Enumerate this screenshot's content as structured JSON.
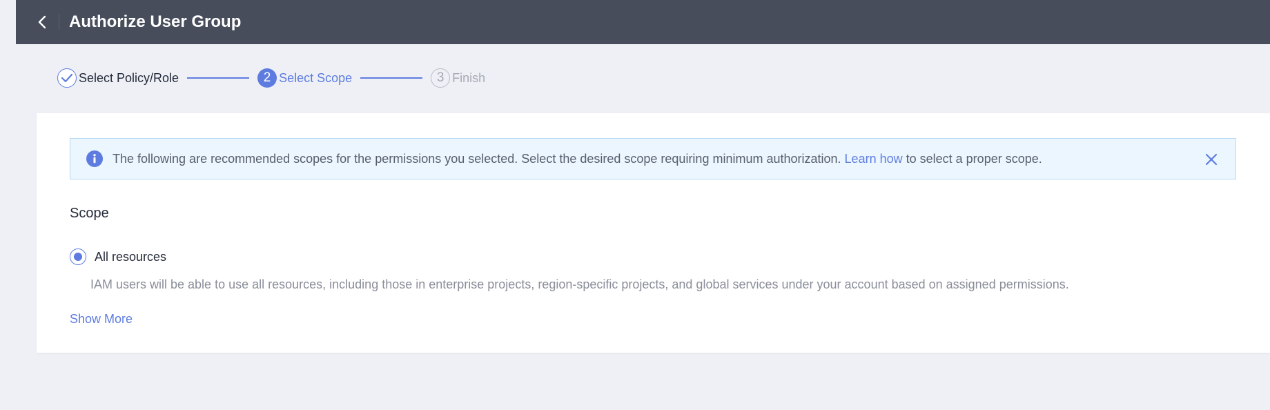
{
  "header": {
    "title": "Authorize User Group",
    "back_icon": "chevron-left-icon"
  },
  "steps": [
    {
      "number": "1",
      "label": "Select Policy/Role",
      "state": "done"
    },
    {
      "number": "2",
      "label": "Select Scope",
      "state": "active"
    },
    {
      "number": "3",
      "label": "Finish",
      "state": "todo"
    }
  ],
  "notice": {
    "text_before": "The following are recommended scopes for the permissions you selected. Select the desired scope requiring minimum authorization.",
    "link": "Learn how",
    "text_after": "to select a proper scope.",
    "icon": "info-icon",
    "close_icon": "close-icon"
  },
  "scope": {
    "title": "Scope",
    "option_label": "All resources",
    "option_selected": true,
    "option_description": "IAM users will be able to use all resources, including those in enterprise projects, region-specific projects, and global services under your account based on assigned permissions.",
    "show_more": "Show More"
  },
  "colors": {
    "header_bg": "#474d5b",
    "accent": "#5e7ce0",
    "page_bg": "#eef0f5",
    "notice_bg": "#ebf6ff"
  }
}
